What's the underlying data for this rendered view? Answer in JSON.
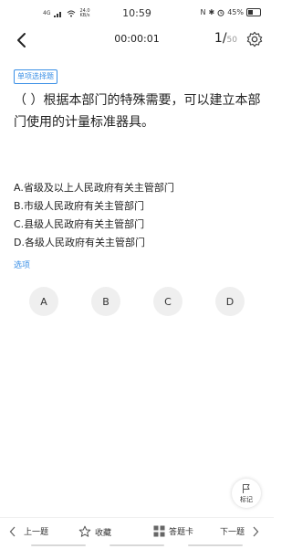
{
  "status": {
    "network": "4G",
    "speed": "24.0\nKB/s",
    "time": "10:59",
    "nfc": "N",
    "bluetooth": "✱",
    "battery_text": "45%",
    "battery_level": 0.45
  },
  "nav": {
    "timer": "00:00:01",
    "current": "1/",
    "total": "50"
  },
  "question": {
    "type_label": "单项选择题",
    "text": "（ ）根据本部门的特殊需要，可以建立本部门使用的计量标准器具。",
    "options": [
      "A.省级及以上人民政府有关主管部门",
      "B.市级人民政府有关主管部门",
      "C.县级人民政府有关主管部门",
      "D.各级人民政府有关主管部门"
    ]
  },
  "answer": {
    "section_label": "选项",
    "choices": [
      "A",
      "B",
      "C",
      "D"
    ]
  },
  "mark": {
    "label": "标记"
  },
  "bottom": {
    "prev": "上一题",
    "favorite": "收藏",
    "answer_card": "答题卡",
    "next": "下一题"
  },
  "colors": {
    "accent": "#3a8fe6",
    "choice_bg": "#efefef"
  }
}
